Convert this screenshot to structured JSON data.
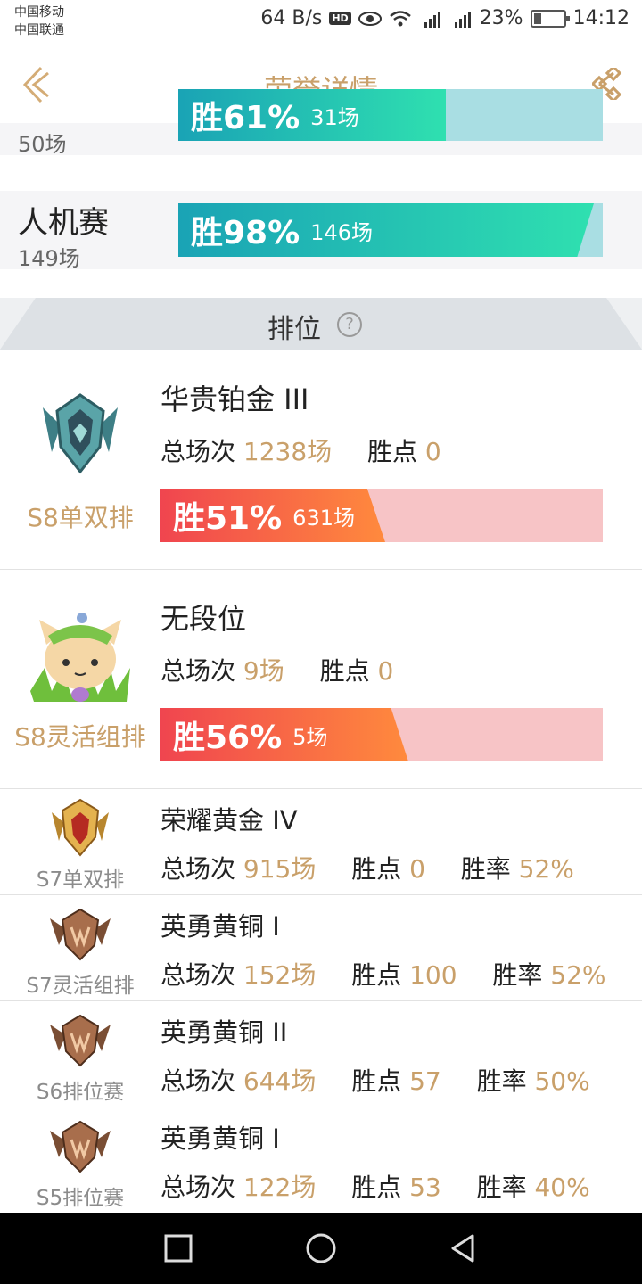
{
  "status_bar": {
    "carrier1": "中国移动",
    "carrier2": "中国联通",
    "speed": "64 B/s",
    "hd": "HD",
    "battery": "23%",
    "time": "14:12"
  },
  "header": {
    "title": "荣誉详情"
  },
  "modes": [
    {
      "name": "",
      "count": "50场",
      "win_pct": "胜61%",
      "games": "31场",
      "win_rate": 0.61
    },
    {
      "name": "人机赛",
      "count": "149场",
      "win_pct": "胜98%",
      "games": "146场",
      "win_rate": 0.98
    }
  ],
  "ranked_header": {
    "label": "排位"
  },
  "ranked_current": [
    {
      "season": "S8单双排",
      "tier": "华贵铂金 III",
      "total_label": "总场次",
      "total": "1238场",
      "points_label": "胜点",
      "points": "0",
      "win_pct": "胜51%",
      "games": "631场",
      "win_rate": 0.51
    },
    {
      "season": "S8灵活组排",
      "tier": "无段位",
      "total_label": "总场次",
      "total": "9场",
      "points_label": "胜点",
      "points": "0",
      "win_pct": "胜56%",
      "games": "5场",
      "win_rate": 0.56
    }
  ],
  "ranked_history": [
    {
      "season": "S7单双排",
      "tier": "荣耀黄金 IV",
      "total_label": "总场次",
      "total": "915场",
      "points_label": "胜点",
      "points": "0",
      "rate_label": "胜率",
      "rate": "52%"
    },
    {
      "season": "S7灵活组排",
      "tier": "英勇黄铜 I",
      "total_label": "总场次",
      "total": "152场",
      "points_label": "胜点",
      "points": "100",
      "rate_label": "胜率",
      "rate": "52%"
    },
    {
      "season": "S6排位赛",
      "tier": "英勇黄铜 II",
      "total_label": "总场次",
      "total": "644场",
      "points_label": "胜点",
      "points": "57",
      "rate_label": "胜率",
      "rate": "50%"
    },
    {
      "season": "S5排位赛",
      "tier": "英勇黄铜 I",
      "total_label": "总场次",
      "total": "122场",
      "points_label": "胜点",
      "points": "53",
      "rate_label": "胜率",
      "rate": "40%"
    }
  ],
  "colors": {
    "accent_gold": "#c9a06a",
    "teal_start": "#1aa3b5",
    "teal_end": "#2fe0b0",
    "red_start": "#f0454f",
    "red_end": "#ff8a3d"
  }
}
